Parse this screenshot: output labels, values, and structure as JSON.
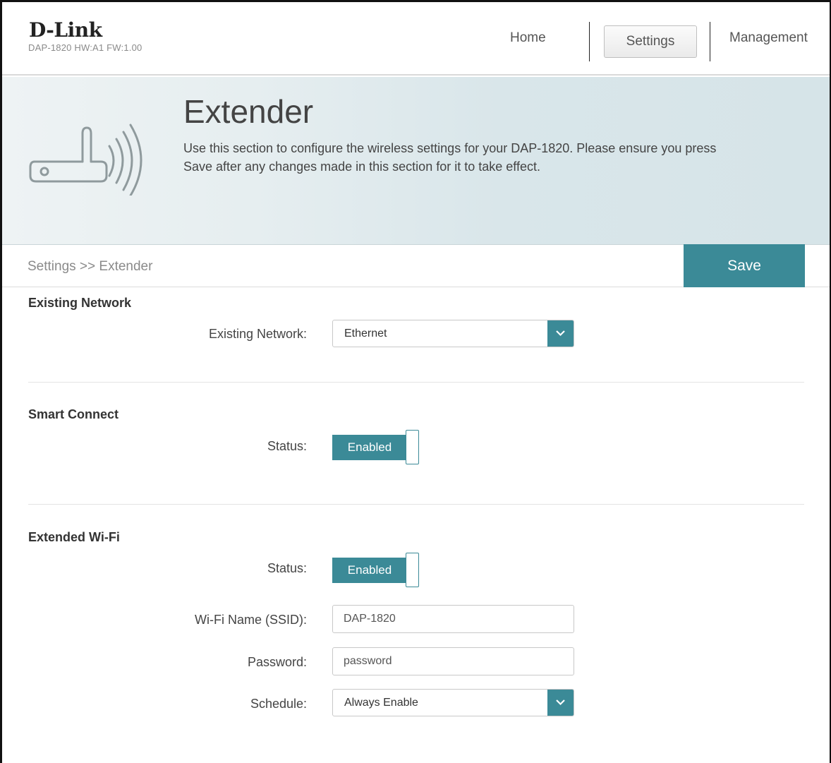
{
  "header": {
    "brand": "D-Link",
    "model_info": "DAP-1820   HW:A1   FW:1.00",
    "nav": {
      "home": "Home",
      "settings": "Settings",
      "management": "Management"
    }
  },
  "banner": {
    "title": "Extender",
    "description": "Use this section to configure the wireless settings for your DAP-1820. Please ensure you press Save after any changes made in this section for it to take effect.",
    "icon": "wireless-extender-icon"
  },
  "breadcrumb": "Settings >> Extender",
  "save_label": "Save",
  "existing_network": {
    "title": "Existing Network",
    "label": "Existing Network:",
    "value": "Ethernet"
  },
  "smart_connect": {
    "title": "Smart Connect",
    "status_label": "Status:",
    "status_value": "Enabled"
  },
  "extended_wifi": {
    "title": "Extended Wi-Fi",
    "status_label": "Status:",
    "status_value": "Enabled",
    "ssid_label": "Wi-Fi Name (SSID):",
    "ssid_value": "DAP-1820",
    "password_label": "Password:",
    "password_value": "password",
    "schedule_label": "Schedule:",
    "schedule_value": "Always Enable"
  },
  "colors": {
    "accent": "#3b8a97"
  }
}
